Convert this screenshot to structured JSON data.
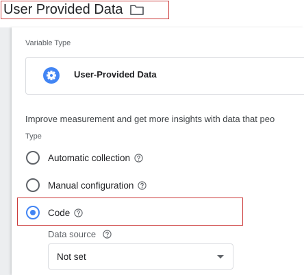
{
  "header": {
    "title": "User Provided Data",
    "folder_icon": "folder-icon"
  },
  "variable_type": {
    "section_label": "Variable Type",
    "name": "User-Provided Data",
    "icon": "gear-icon",
    "icon_color": "#4285f4"
  },
  "description": "Improve measurement and get more insights with data that peo",
  "type_section": {
    "label": "Type",
    "options": [
      {
        "label": "Automatic collection",
        "selected": false
      },
      {
        "label": "Manual configuration",
        "selected": false
      },
      {
        "label": "Code",
        "selected": true
      }
    ]
  },
  "data_source": {
    "label": "Data source",
    "value": "Not set"
  },
  "colors": {
    "accent": "#4285f4",
    "highlight": "#cc3b3b"
  }
}
